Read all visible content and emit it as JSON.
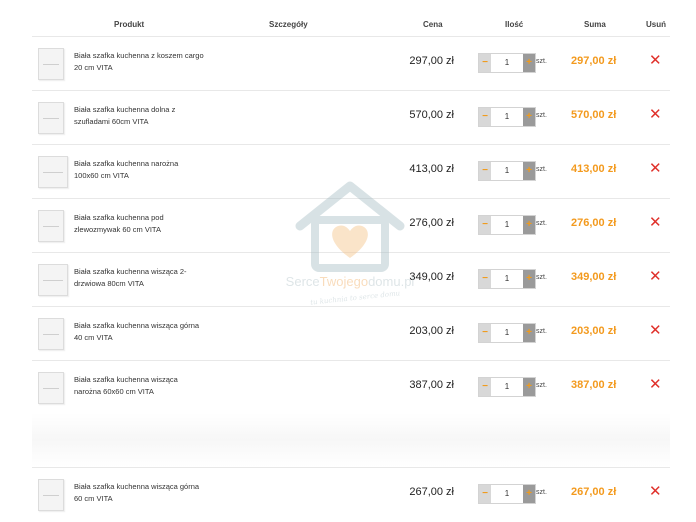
{
  "header": {
    "product": "Produkt",
    "details": "Szczegóły",
    "price": "Cena",
    "quantity": "Ilość",
    "total": "Suma",
    "remove": "Usuń"
  },
  "unit_label": "szt.",
  "currency_color": "#f39a1e",
  "remove_color": "#e0312b",
  "items": [
    {
      "name": "Biała szafka kuchenna z koszem cargo 20 cm VITA",
      "price": "297,00 zł",
      "qty": "1",
      "sum": "297,00 zł"
    },
    {
      "name": "Biała szafka kuchenna dolna z szufladami 60cm VITA",
      "price": "570,00 zł",
      "qty": "1",
      "sum": "570,00 zł"
    },
    {
      "name": "Biała szafka kuchenna narożna 100x60 cm VITA",
      "price": "413,00 zł",
      "qty": "1",
      "sum": "413,00 zł"
    },
    {
      "name": "Biała szafka kuchenna pod zlewozmywak 60 cm VITA",
      "price": "276,00 zł",
      "qty": "1",
      "sum": "276,00 zł"
    },
    {
      "name": "Biała szafka kuchenna wisząca 2-drzwiowa 80cm VITA",
      "price": "349,00 zł",
      "qty": "1",
      "sum": "349,00 zł"
    },
    {
      "name": "Biała szafka kuchenna wisząca górna 40 cm VITA",
      "price": "203,00 zł",
      "qty": "1",
      "sum": "203,00 zł"
    },
    {
      "name": "Biała szafka kuchenna wisząca narożna 60x60 cm VITA",
      "price": "387,00 zł",
      "qty": "1",
      "sum": "387,00 zł"
    },
    {
      "name": "Biała szafka kuchenna wisząca górna 60 cm VITA",
      "price": "267,00 zł",
      "qty": "1",
      "sum": "267,00 zł"
    }
  ],
  "watermark": {
    "brand_a": "Serce",
    "brand_b": "Twojego",
    "brand_c": "domu.pl",
    "tagline": "tu kuchnia to serce domu"
  }
}
